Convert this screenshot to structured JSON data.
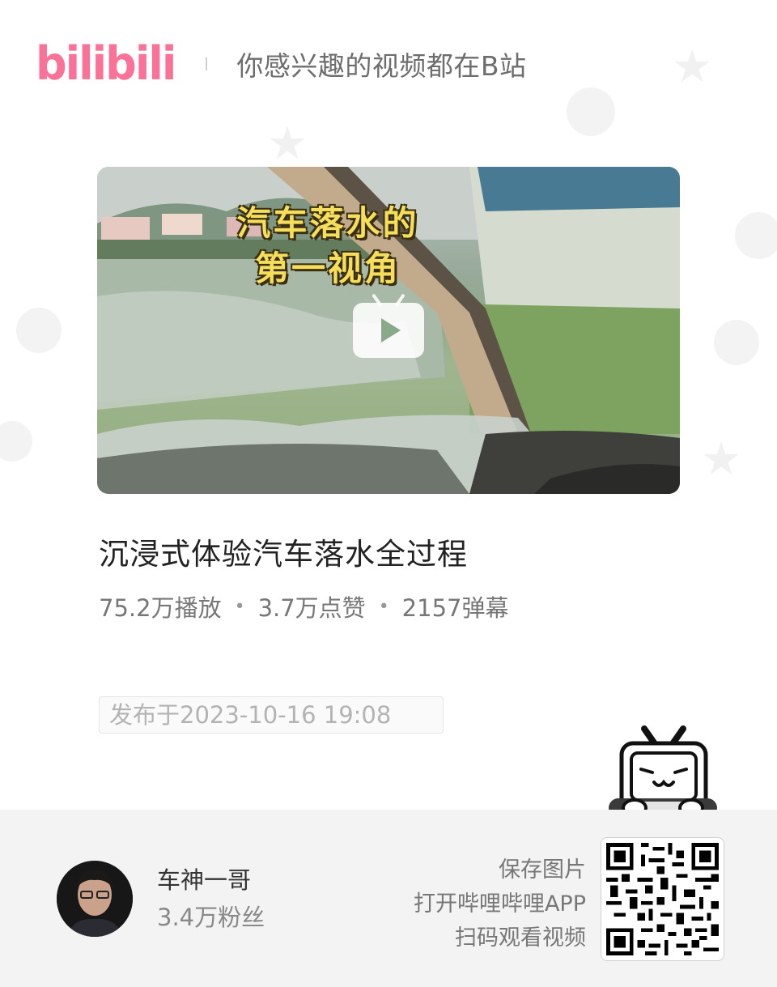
{
  "header": {
    "logo_text": "bilibili",
    "slogan": "你感兴趣的视频都在B站"
  },
  "cover": {
    "caption_line1": "汽车落水的",
    "caption_line2": "第一视角"
  },
  "video": {
    "title": "沉浸式体验汽车落水全过程",
    "plays": "75.2万播放",
    "likes": "3.7万点赞",
    "danmaku": "2157弹幕",
    "publish_date": "发布于2023-10-16 19:08"
  },
  "footer": {
    "uploader_name": "车神一哥",
    "uploader_fans": "3.4万粉丝",
    "hint_line1": "保存图片",
    "hint_line2": "打开哔哩哔哩APP",
    "hint_line3": "扫码观看视频"
  },
  "colors": {
    "brand_pink": "#fb7299",
    "footer_bg": "#f3f3f3"
  },
  "icons": [
    "play-icon",
    "tv-mascot-icon",
    "qr-code-icon"
  ]
}
